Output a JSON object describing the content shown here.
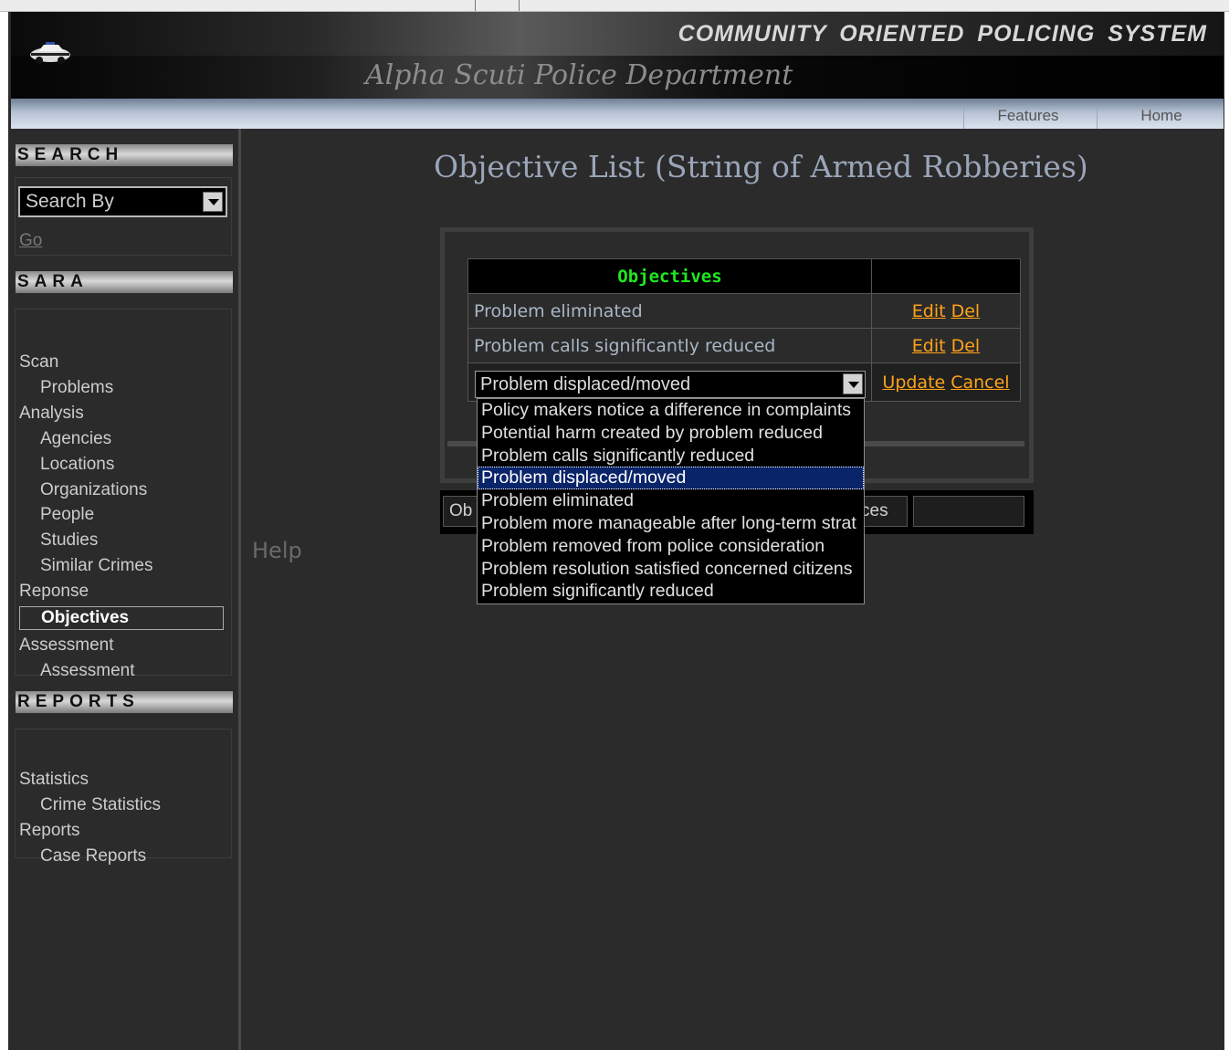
{
  "header": {
    "system_title": "COMMUNITY ORIENTED POLICING SYSTEM",
    "department": "Alpha Scuti Police Department"
  },
  "nav": {
    "features": "Features",
    "home": "Home"
  },
  "sidebar": {
    "search": {
      "heading": "SEARCH",
      "select_value": "Search By",
      "go_label": "Go"
    },
    "sara": {
      "heading": "SARA",
      "items": [
        {
          "label": "Scan",
          "level": "top"
        },
        {
          "label": "Problems",
          "level": "sub"
        },
        {
          "label": "Analysis",
          "level": "top"
        },
        {
          "label": "Agencies",
          "level": "sub"
        },
        {
          "label": "Locations",
          "level": "sub"
        },
        {
          "label": "Organizations",
          "level": "sub"
        },
        {
          "label": "People",
          "level": "sub"
        },
        {
          "label": "Studies",
          "level": "sub"
        },
        {
          "label": "Similar Crimes",
          "level": "sub"
        },
        {
          "label": "Reponse",
          "level": "top"
        },
        {
          "label": "Objectives",
          "level": "active"
        },
        {
          "label": "Assessment",
          "level": "top"
        },
        {
          "label": "Assessment",
          "level": "sub"
        }
      ]
    },
    "reports": {
      "heading": "REPORTS",
      "items": [
        {
          "label": "Statistics",
          "level": "top"
        },
        {
          "label": "Crime Statistics",
          "level": "sub"
        },
        {
          "label": "Reports",
          "level": "top"
        },
        {
          "label": "Case Reports",
          "level": "sub"
        }
      ]
    },
    "help_label": "Help"
  },
  "main": {
    "title": "Objective List (String of Armed Robberies)",
    "table": {
      "header": "Objectives",
      "rows": [
        {
          "name": "Problem eliminated",
          "edit": "Edit",
          "del": "Del"
        },
        {
          "name": "Problem calls significantly reduced",
          "edit": "Edit",
          "del": "Del"
        }
      ],
      "edit_row": {
        "selected": "Problem displaced/moved",
        "update": "Update",
        "cancel": "Cancel"
      }
    },
    "dropdown_options": [
      "Policy makers notice a difference in complaints",
      "Potential harm created by problem reduced",
      "Problem calls significantly reduced",
      "Problem displaced/moved",
      "Problem eliminated",
      "Problem more manageable after long-term strat",
      "Problem removed from police consideration",
      "Problem resolution satisfied concerned citizens",
      "Problem significantly reduced"
    ],
    "dropdown_selected_index": 3,
    "bottom_bar": {
      "b1": "Ob",
      "b2": "ces",
      "b3": ""
    }
  },
  "colors": {
    "accent_link": "#ffa21a",
    "table_header_text": "#1fe81f",
    "selection": "#0a246a"
  }
}
